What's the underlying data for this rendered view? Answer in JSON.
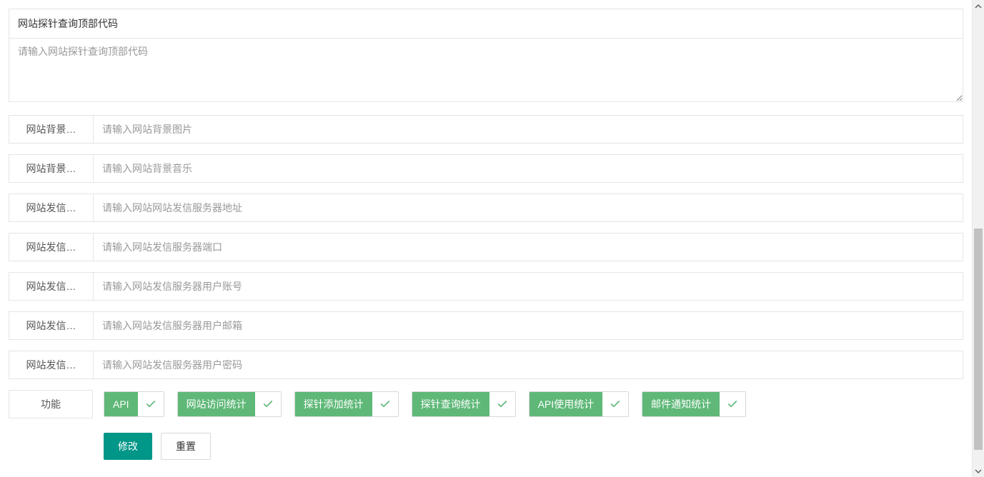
{
  "textarea_section": {
    "label": "网站探针查询顶部代码",
    "placeholder": "请输入网站探针查询顶部代码"
  },
  "fields": [
    {
      "label": "网站背景…",
      "placeholder": "请输入网站背景图片",
      "name": "bg-image-field"
    },
    {
      "label": "网站背景…",
      "placeholder": "请输入网站背景音乐",
      "name": "bg-music-field"
    },
    {
      "label": "网站发信…",
      "placeholder": "请输入网站网站发信服务器地址",
      "name": "mail-server-field"
    },
    {
      "label": "网站发信…",
      "placeholder": "请输入网站发信服务器端口",
      "name": "mail-port-field"
    },
    {
      "label": "网站发信…",
      "placeholder": "请输入网站发信服务器用户账号",
      "name": "mail-user-field"
    },
    {
      "label": "网站发信…",
      "placeholder": "请输入网站发信服务器用户邮箱",
      "name": "mail-email-field"
    },
    {
      "label": "网站发信…",
      "placeholder": "请输入网站发信服务器用户密码",
      "name": "mail-password-field"
    }
  ],
  "functions": {
    "label": "功能",
    "items": [
      {
        "label": "API",
        "name": "toggle-api"
      },
      {
        "label": "网站访问统计",
        "name": "toggle-visit-stats"
      },
      {
        "label": "探针添加统计",
        "name": "toggle-probe-add-stats"
      },
      {
        "label": "探针查询统计",
        "name": "toggle-probe-query-stats"
      },
      {
        "label": "API使用统计",
        "name": "toggle-api-usage-stats"
      },
      {
        "label": "邮件通知统计",
        "name": "toggle-mail-notify-stats"
      }
    ]
  },
  "buttons": {
    "submit": "修改",
    "reset": "重置"
  }
}
